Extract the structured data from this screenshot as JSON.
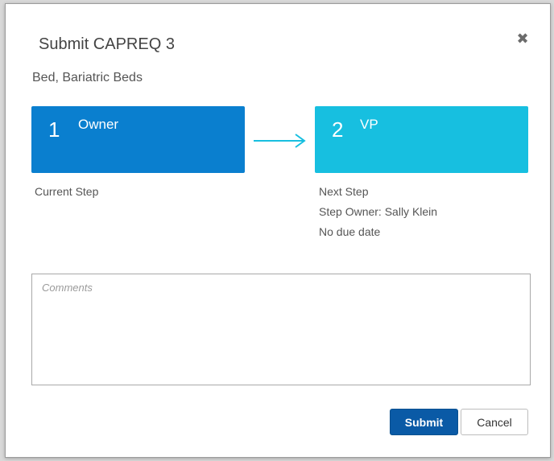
{
  "dialog": {
    "title": "Submit CAPREQ 3",
    "subtitle": "Bed, Bariatric Beds",
    "close_glyph": "✖"
  },
  "steps": {
    "current": {
      "number": "1",
      "name": "Owner",
      "color": "#0a7fcf"
    },
    "next": {
      "number": "2",
      "name": "VP",
      "color": "#17bfe0"
    }
  },
  "current_info": {
    "label": "Current Step"
  },
  "next_info": {
    "label": "Next Step",
    "owner": "Step Owner: Sally Klein",
    "due": "No due date"
  },
  "comments": {
    "placeholder": "Comments",
    "value": ""
  },
  "buttons": {
    "submit_label": "Submit",
    "cancel_label": "Cancel",
    "submit_color": "#0a5aa6"
  },
  "icons": {
    "close": "close-icon",
    "arrow": "arrow-right-icon"
  }
}
